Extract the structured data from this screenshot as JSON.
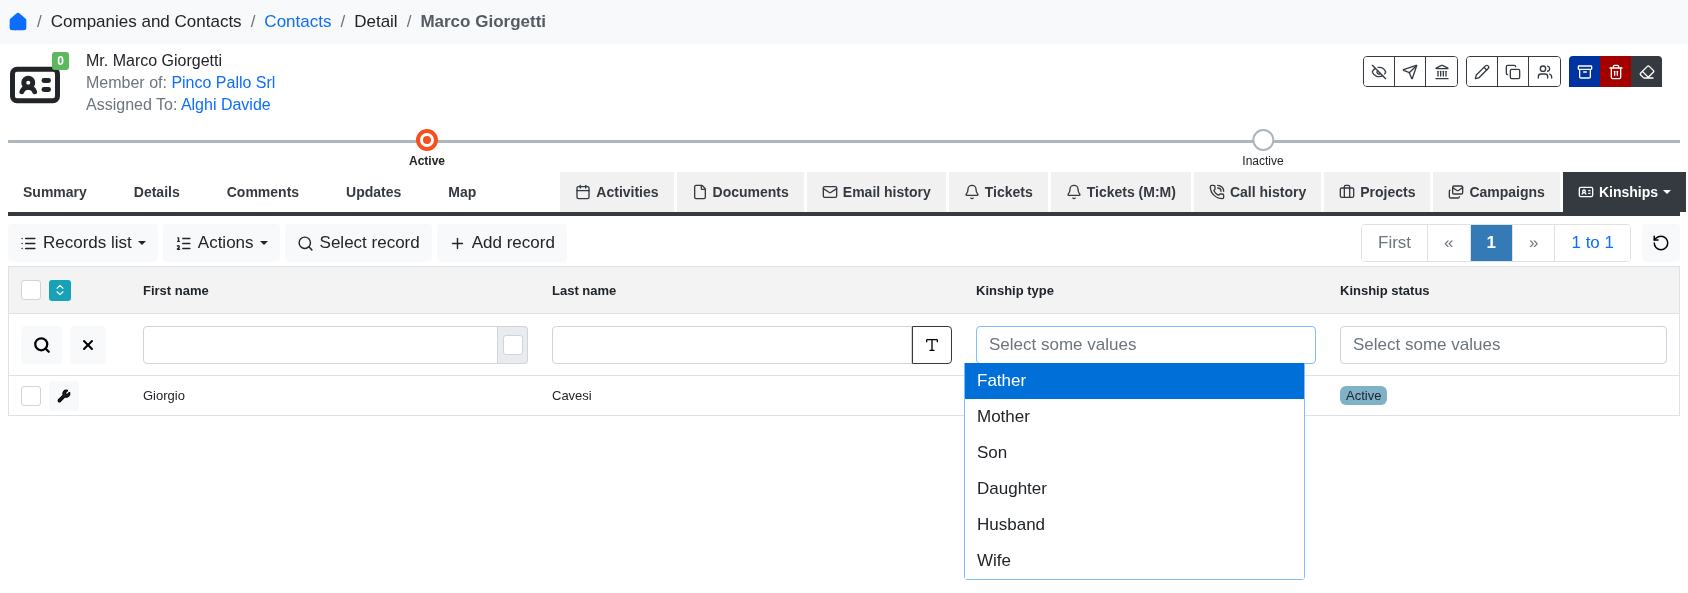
{
  "breadcrumb": [
    {
      "separator": "/",
      "label": "Companies and Contacts",
      "kind": "text"
    },
    {
      "separator": "/",
      "label": "Contacts",
      "kind": "link"
    },
    {
      "separator": "/",
      "label": "Detail",
      "kind": "text"
    },
    {
      "separator": "/",
      "label": "Marco Giorgetti",
      "kind": "current"
    }
  ],
  "header": {
    "badge": "0",
    "title": "Mr. Marco Giorgetti",
    "member_label": "Member of:",
    "member_link": "Pinco Pallo Srl",
    "assigned_label": "Assigned To:",
    "assigned_link": "Alghi Davide"
  },
  "solid_buttons": [
    {
      "color": "#0032a0"
    },
    {
      "color": "#a50000"
    },
    {
      "color": "#343a40"
    }
  ],
  "progress": [
    {
      "label": "Active",
      "selected": true
    },
    {
      "label": "Inactive",
      "selected": false
    }
  ],
  "tabs": [
    {
      "label": "Summary",
      "kind": "plain",
      "selected": false
    },
    {
      "label": "Details",
      "kind": "plain",
      "selected": false
    },
    {
      "label": "Comments",
      "kind": "plain",
      "selected": false
    },
    {
      "label": "Updates",
      "kind": "plain",
      "selected": false
    },
    {
      "label": "Map",
      "kind": "plain",
      "selected": false
    },
    {
      "label": "Activities",
      "kind": "boxed",
      "selected": false
    },
    {
      "label": "Documents",
      "kind": "boxed",
      "selected": false
    },
    {
      "label": "Email history",
      "kind": "boxed",
      "selected": false
    },
    {
      "label": "Tickets",
      "kind": "boxed",
      "selected": false
    },
    {
      "label": "Tickets (M:M)",
      "kind": "boxed",
      "selected": false
    },
    {
      "label": "Call history",
      "kind": "boxed",
      "selected": false
    },
    {
      "label": "Projects",
      "kind": "boxed",
      "selected": false
    },
    {
      "label": "Campaigns",
      "kind": "boxed",
      "selected": false
    },
    {
      "label": "Kinships",
      "kind": "dropdown",
      "selected": true
    }
  ],
  "toolbar": [
    {
      "label": "Records list",
      "kind": "dropdown"
    },
    {
      "label": "Actions",
      "kind": "dropdown"
    },
    {
      "label": "Select record",
      "kind": "plain"
    },
    {
      "label": "Add record",
      "kind": "plain"
    }
  ],
  "pagination": [
    {
      "label": "First",
      "selected": false
    },
    {
      "label": "«",
      "selected": false
    },
    {
      "label": "1",
      "selected": true
    },
    {
      "label": "»",
      "selected": false
    },
    {
      "label": "1 to 1",
      "selected": false
    }
  ],
  "table": {
    "select_all_checked": false,
    "columns": [
      {
        "label": "First name"
      },
      {
        "label": "Last name"
      },
      {
        "label": "Kinship type"
      },
      {
        "label": "Kinship status"
      }
    ],
    "filters": [
      {
        "kind": "text-toggle",
        "toggle_checked": false
      },
      {
        "kind": "text-font"
      },
      {
        "kind": "multiselect",
        "placeholder": "Select some values",
        "open": true
      },
      {
        "kind": "multiselect",
        "placeholder": "Select some values",
        "open": false
      }
    ],
    "rows": [
      {
        "checked": false,
        "first_name": "Giorgio",
        "last_name": "Cavesi",
        "status": "Active"
      }
    ]
  },
  "dropdown_options": [
    {
      "label": "Father",
      "selected": true
    },
    {
      "label": "Mother",
      "selected": false
    },
    {
      "label": "Son",
      "selected": false
    },
    {
      "label": "Daughter",
      "selected": false
    },
    {
      "label": "Husband",
      "selected": false
    },
    {
      "label": "Wife",
      "selected": false
    }
  ]
}
